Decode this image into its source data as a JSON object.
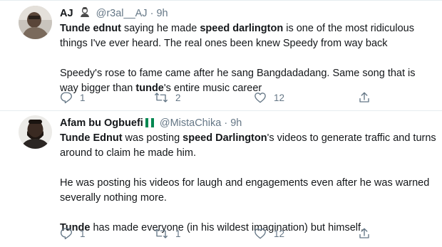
{
  "tweets": [
    {
      "display_name": "AJ",
      "handle": "@r3al__AJ",
      "separator": "·",
      "time": "9h",
      "paragraphs": [
        [
          {
            "text": "Tunde ednut",
            "bold": true
          },
          {
            "text": " saying he made ",
            "bold": false
          },
          {
            "text": "speed darlington",
            "bold": true
          },
          {
            "text": " is one of the most ridiculous things I've ever heard. The real ones been knew Speedy from way back",
            "bold": false
          }
        ],
        [
          {
            "text": "Speedy's rose to fame came after he sang Bangdadadang. Same song that is way bigger than ",
            "bold": false
          },
          {
            "text": "tunde",
            "bold": true
          },
          {
            "text": "'s entire music career",
            "bold": false
          }
        ]
      ],
      "replies": "1",
      "retweets": "2",
      "likes": "12"
    },
    {
      "display_name": "Afam bu Ogbuefi",
      "handle": "@MistaChika",
      "separator": "·",
      "time": "9h",
      "paragraphs": [
        [
          {
            "text": "Tunde Ednut",
            "bold": true
          },
          {
            "text": " was posting ",
            "bold": false
          },
          {
            "text": "speed Darlington",
            "bold": true
          },
          {
            "text": "'s videos to generate traffic and turns around to claim he made him.",
            "bold": false
          }
        ],
        [
          {
            "text": "He was posting his videos for laugh and engagements even after he was warned severally nothing more.",
            "bold": false
          }
        ],
        [
          {
            "text": "Tunde",
            "bold": true
          },
          {
            "text": " has made everyone (in his wildest imagination) but himself.",
            "bold": false
          }
        ]
      ],
      "replies": "1",
      "retweets": "1",
      "likes": "12"
    }
  ],
  "colors": {
    "text": "#14171a",
    "secondary": "#657786",
    "divider": "#e6ecf0",
    "flag_green": "#008751"
  },
  "icons": {
    "reply": "reply-icon",
    "retweet": "retweet-icon",
    "like": "heart-icon",
    "share": "share-icon"
  }
}
